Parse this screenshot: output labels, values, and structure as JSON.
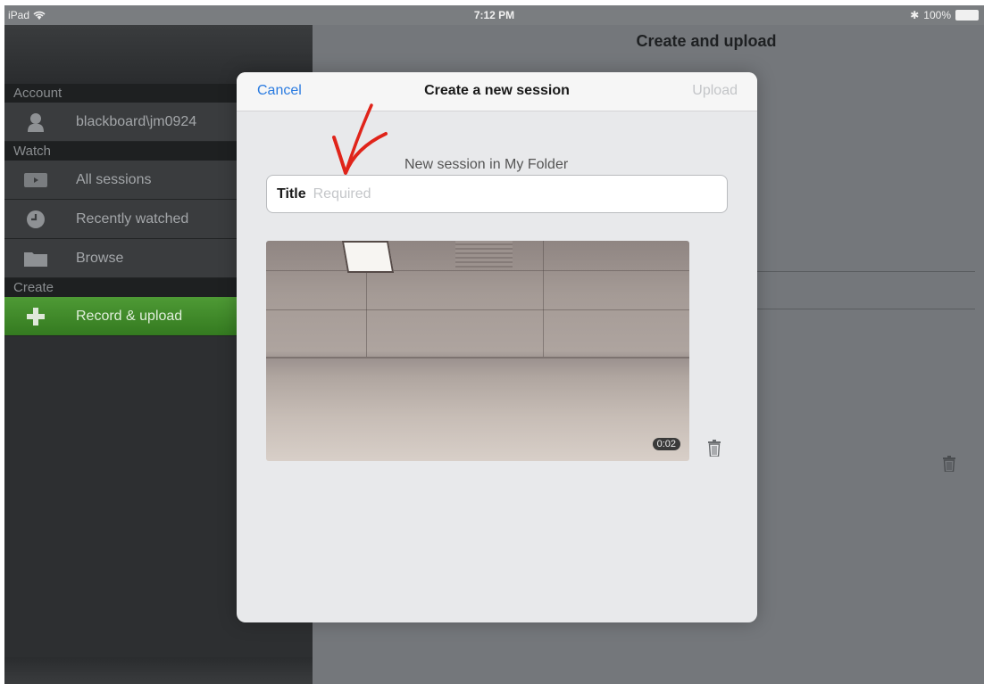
{
  "status_bar": {
    "device": "iPad",
    "time": "7:12 PM",
    "battery": "100%"
  },
  "sidebar": {
    "sections": [
      {
        "header": "Account",
        "items": [
          {
            "label": "blackboard\\jm0924",
            "icon": "user-icon"
          }
        ]
      },
      {
        "header": "Watch",
        "items": [
          {
            "label": "All sessions",
            "icon": "video-icon"
          },
          {
            "label": "Recently watched",
            "icon": "clock-icon"
          },
          {
            "label": "Browse",
            "icon": "folder-icon"
          }
        ]
      },
      {
        "header": "Create",
        "items": [
          {
            "label": "Record & upload",
            "icon": "plus-icon",
            "active": true
          }
        ]
      }
    ]
  },
  "main": {
    "title": "Create and upload"
  },
  "modal": {
    "cancel_label": "Cancel",
    "title": "Create a new session",
    "upload_label": "Upload",
    "subtitle": "New session in My Folder",
    "title_field": {
      "label": "Title",
      "placeholder": "Required",
      "value": ""
    },
    "video": {
      "duration": "0:02"
    }
  },
  "colors": {
    "accent": "#2a7be0",
    "sidebar_active": "#3f8a2a",
    "annotation": "#e0241a"
  }
}
